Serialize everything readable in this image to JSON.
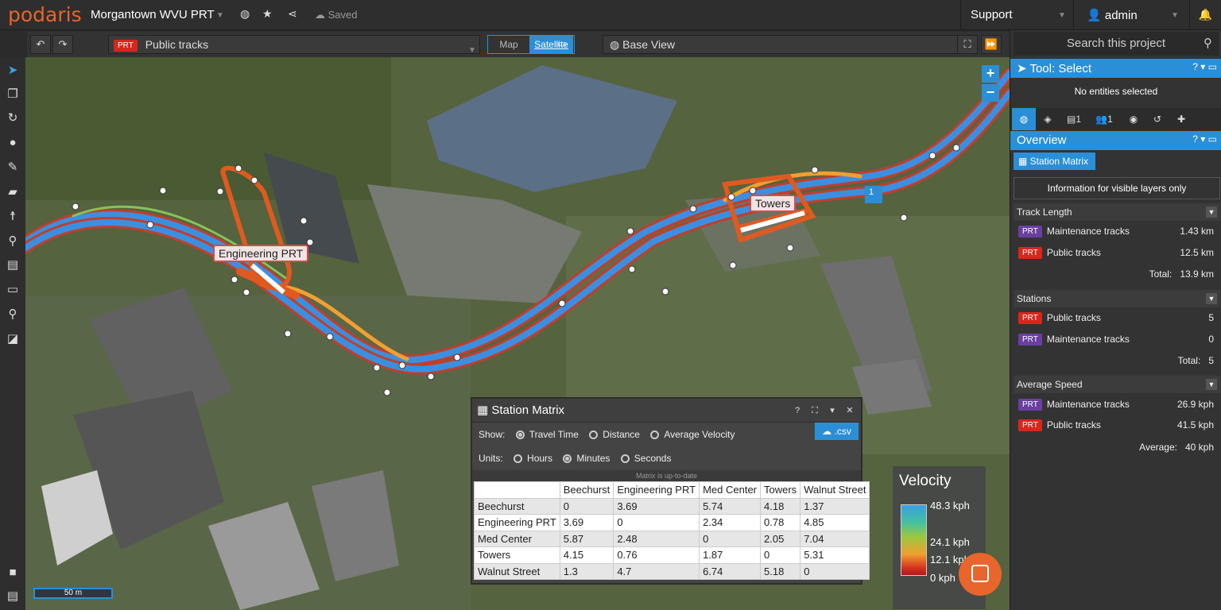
{
  "header": {
    "logo": "podaris",
    "project_title": "Morgantown WVU PRT",
    "saved": "Saved",
    "support": "Support",
    "user": "admin"
  },
  "toolbar": {
    "layer_tag": "PRT",
    "layer_name": "Public tracks",
    "map_label": "Map",
    "satellite_label": "Satellite",
    "base_view": "Base View"
  },
  "map": {
    "label_engineering": "Engineering PRT",
    "label_towers": "Towers",
    "marker_count": "1",
    "scale": "50 m",
    "zoom_in": "+",
    "zoom_out": "−"
  },
  "velocity": {
    "title": "Velocity",
    "labels": [
      "48.3 kph",
      "24.1 kph",
      "12.1 kph",
      "0 kph"
    ]
  },
  "matrix": {
    "title": "Station Matrix",
    "show_label": "Show:",
    "show_options": [
      "Travel Time",
      "Distance",
      "Average Velocity"
    ],
    "units_label": "Units:",
    "unit_options": [
      "Hours",
      "Minutes",
      "Seconds"
    ],
    "csv": ".csv",
    "status": "Matrix is up-to-date",
    "columns": [
      "",
      "Beechurst",
      "Engineering PRT",
      "Med Center",
      "Towers",
      "Walnut Street"
    ],
    "rows": [
      [
        "Beechurst",
        "0",
        "3.69",
        "5.74",
        "4.18",
        "1.37"
      ],
      [
        "Engineering PRT",
        "3.69",
        "0",
        "2.34",
        "0.78",
        "4.85"
      ],
      [
        "Med Center",
        "5.87",
        "2.48",
        "0",
        "2.05",
        "7.04"
      ],
      [
        "Towers",
        "4.15",
        "0.76",
        "1.87",
        "0",
        "5.31"
      ],
      [
        "Walnut Street",
        "1.3",
        "4.7",
        "6.74",
        "5.18",
        "0"
      ]
    ]
  },
  "panel": {
    "search_placeholder": "Search this project",
    "tool_title": "Tool: Select",
    "no_entities": "No entities selected",
    "tab_comments_count": "1",
    "tab_users_count": "1",
    "overview_title": "Overview",
    "station_matrix_btn": "Station Matrix",
    "info": "Information for visible layers only",
    "track_length": {
      "title": "Track Length",
      "rows": [
        {
          "tag": "PRT",
          "name": "Maintenance tracks",
          "value": "1.43 km"
        },
        {
          "tag": "PRT",
          "name": "Public tracks",
          "value": "12.5 km"
        }
      ],
      "total_label": "Total:",
      "total_value": "13.9 km"
    },
    "stations": {
      "title": "Stations",
      "rows": [
        {
          "tag": "PRT",
          "name": "Public tracks",
          "value": "5"
        },
        {
          "tag": "PRT",
          "name": "Maintenance tracks",
          "value": "0"
        }
      ],
      "total_label": "Total:",
      "total_value": "5"
    },
    "avg_speed": {
      "title": "Average Speed",
      "rows": [
        {
          "tag": "PRT",
          "name": "Maintenance tracks",
          "value": "26.9 kph"
        },
        {
          "tag": "PRT",
          "name": "Public tracks",
          "value": "41.5 kph"
        }
      ],
      "total_label": "Average:",
      "total_value": "40 kph"
    }
  },
  "colors": {
    "accent": "#2a8fd6",
    "brand": "#e8652b",
    "prt_red": "#d9261c",
    "prt_purple": "#6b3fa0"
  }
}
